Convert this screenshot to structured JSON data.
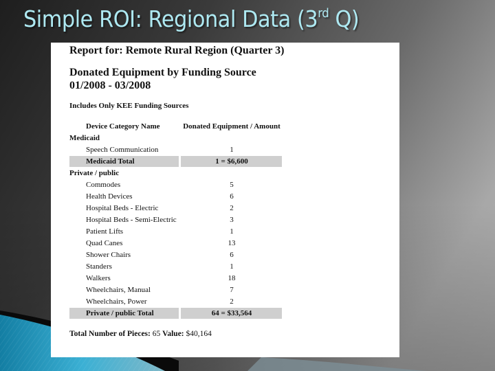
{
  "slide": {
    "title_main": "Simple ROI: Regional Data (3",
    "title_sup": "rd",
    "title_end": " Q)"
  },
  "report": {
    "heading": "Report for: Remote Rural Region (Quarter 3)",
    "subheading_line1": "Donated Equipment by Funding Source",
    "subheading_line2": "01/2008 - 03/2008",
    "note": "Includes Only KEE Funding Sources",
    "columns": [
      "Device Category Name",
      "Donated Equipment / Amount"
    ],
    "groups": [
      {
        "name": "Medicaid",
        "items": [
          {
            "name": "Speech Communication",
            "value": "1"
          }
        ],
        "total_label": "Medicaid Total",
        "total_value": "1 = $6,600"
      },
      {
        "name": "Private / public",
        "items": [
          {
            "name": "Commodes",
            "value": "5"
          },
          {
            "name": "Health Devices",
            "value": "6"
          },
          {
            "name": "Hospital Beds - Electric",
            "value": "2"
          },
          {
            "name": "Hospital Beds - Semi-Electric",
            "value": "3"
          },
          {
            "name": "Patient Lifts",
            "value": "1"
          },
          {
            "name": "Quad Canes",
            "value": "13"
          },
          {
            "name": "Shower Chairs",
            "value": "6"
          },
          {
            "name": "Standers",
            "value": "1"
          },
          {
            "name": "Walkers",
            "value": "18"
          },
          {
            "name": "Wheelchairs, Manual",
            "value": "7"
          },
          {
            "name": "Wheelchairs, Power",
            "value": "2"
          }
        ],
        "total_label": "Private / public Total",
        "total_value": "64 = $33,564"
      }
    ],
    "grand_total": {
      "pieces_label": "Total Number of Pieces:",
      "pieces_value": "65",
      "value_label": "Value:",
      "value_value": "$40,164"
    }
  },
  "colors": {
    "title": "#aee9f2",
    "total_row_shade": "#cfcfcf",
    "swoosh_blue": "#1f8fb5"
  }
}
